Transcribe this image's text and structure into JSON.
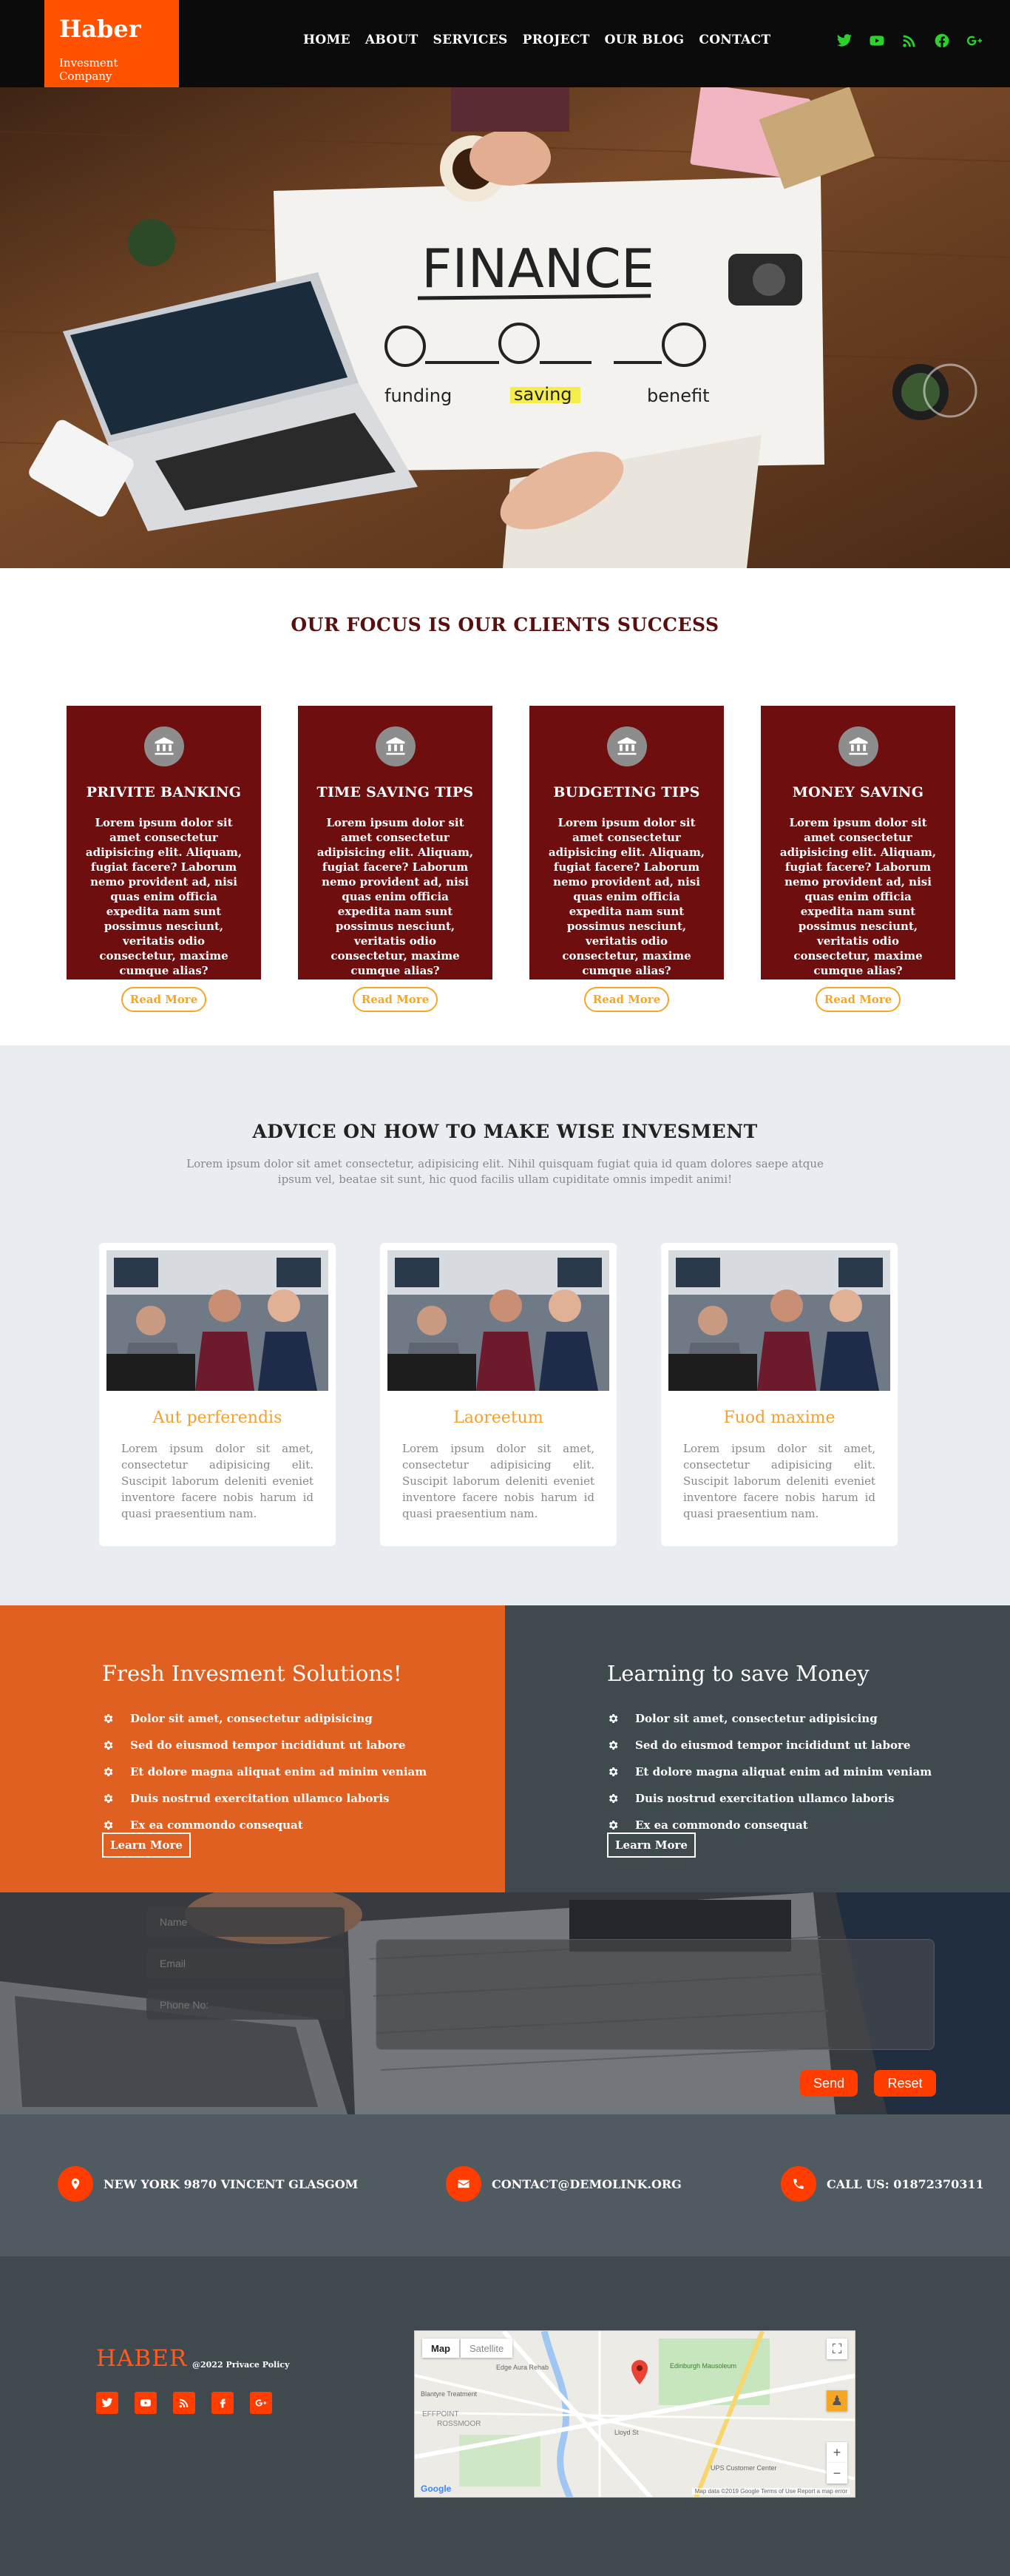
{
  "header": {
    "brand": "Haber",
    "tagline": "Invesment Company",
    "nav": [
      "HOME",
      "ABOUT",
      "SERVICES",
      "PROJECT",
      "OUR BLOG",
      "CONTACT"
    ],
    "social_icons": [
      "twitter-icon",
      "youtube-icon",
      "rss-icon",
      "facebook-icon",
      "google-plus-icon"
    ],
    "accent_color": "#ff5200",
    "social_color": "#2bd22b"
  },
  "hero": {
    "words": [
      "FINANCE",
      "funding",
      "saving",
      "benefit"
    ]
  },
  "focus": {
    "title": "OUR FOCUS IS OUR CLIENTS SUCCESS",
    "card_color": "#6e0e0e",
    "cards": [
      {
        "title": "PRIVITE BANKING",
        "text": "Lorem ipsum dolor sit amet consectetur adipisicing elit. Aliquam, fugiat facere? Laborum nemo provident ad, nisi quas enim officia expedita nam sunt possimus nesciunt, veritatis odio consectetur, maxime cumque alias?",
        "button": "Read More",
        "icon": "bank-icon"
      },
      {
        "title": "TIME SAVING TIPS",
        "text": "Lorem ipsum dolor sit amet consectetur adipisicing elit. Aliquam, fugiat facere? Laborum nemo provident ad, nisi quas enim officia expedita nam sunt possimus nesciunt, veritatis odio consectetur, maxime cumque alias?",
        "button": "Read More",
        "icon": "bank-icon"
      },
      {
        "title": "BUDGETING TIPS",
        "text": "Lorem ipsum dolor sit amet consectetur adipisicing elit. Aliquam, fugiat facere? Laborum nemo provident ad, nisi quas enim officia expedita nam sunt possimus nesciunt, veritatis odio consectetur, maxime cumque alias?",
        "button": "Read More",
        "icon": "bank-icon"
      },
      {
        "title": "MONEY SAVING",
        "text": "Lorem ipsum dolor sit amet consectetur adipisicing elit. Aliquam, fugiat facere? Laborum nemo provident ad, nisi quas enim officia expedita nam sunt possimus nesciunt, veritatis odio consectetur, maxime cumque alias?",
        "button": "Read More",
        "icon": "bank-icon"
      }
    ]
  },
  "advice": {
    "title": "ADVICE ON HOW TO MAKE WISE INVESMENT",
    "subtitle": "Lorem ipsum dolor sit amet consectetur, adipisicing elit. Nihil quisquam fugiat quia id quam dolores saepe atque ipsum vel, beatae sit sunt, hic quod facilis ullam cupiditate omnis impedit animi!",
    "cards": [
      {
        "title": "Aut perferendis",
        "text": "Lorem ipsum dolor sit amet, consectetur adipisicing elit. Suscipit laborum deleniti eveniet inventore facere nobis harum id quasi praesentium nam."
      },
      {
        "title": "Laoreetum",
        "text": "Lorem ipsum dolor sit amet, consectetur adipisicing elit. Suscipit laborum deleniti eveniet inventore facere nobis harum id quasi praesentium nam."
      },
      {
        "title": "Fuod maxime",
        "text": "Lorem ipsum dolor sit amet, consectetur adipisicing elit. Suscipit laborum deleniti eveniet inventore facere nobis harum id quasi praesentium nam."
      }
    ]
  },
  "solutions": {
    "left": {
      "title": "Fresh Invesment Solutions!",
      "items": [
        "Dolor sit amet, consectetur adipisicing",
        "Sed do eiusmod tempor incididunt ut labore",
        "Et dolore magna aliquat enim ad minim veniam",
        "Duis nostrud exercitation ullamco laboris",
        "Ex ea commondo consequat"
      ],
      "button": "Learn More",
      "color": "#e06022"
    },
    "right": {
      "title": "Learning to save Money",
      "items": [
        "Dolor sit amet, consectetur adipisicing",
        "Sed do eiusmod tempor incididunt ut labore",
        "Et dolore magna aliquat enim ad minim veniam",
        "Duis nostrud exercitation ullamco laboris",
        "Ex ea commondo consequat"
      ],
      "button": "Learn More",
      "color": "#3f4a4f"
    }
  },
  "form": {
    "name_placeholder": "Name",
    "email_placeholder": "Email",
    "phone_placeholder": "Phone No:",
    "send": "Send",
    "reset": "Reset"
  },
  "contact": {
    "address": "NEW YORK 9870 VINCENT GLASGOM",
    "email": "CONTACT@DEMOLINK.ORG",
    "phone": "CALL US: 01872370311"
  },
  "footer": {
    "brand": "HABER",
    "copyright": "@2022 Privace Policy",
    "social_icons": [
      "twitter-icon",
      "youtube-icon",
      "rss-icon",
      "facebook-icon",
      "google-plus-icon"
    ],
    "map": {
      "tab_map": "Map",
      "tab_satellite": "Satellite",
      "logo": "Google",
      "terms": "Map data ©2019 Google   Terms of Use   Report a map error",
      "labels": [
        "Edge Aura Rehab",
        "Edinburgh Mausoleum",
        "Blantyre Treatment",
        "Lloyd St",
        "UPS Customer Center",
        "ROSSMOOR",
        "EFFPOINT"
      ]
    }
  }
}
